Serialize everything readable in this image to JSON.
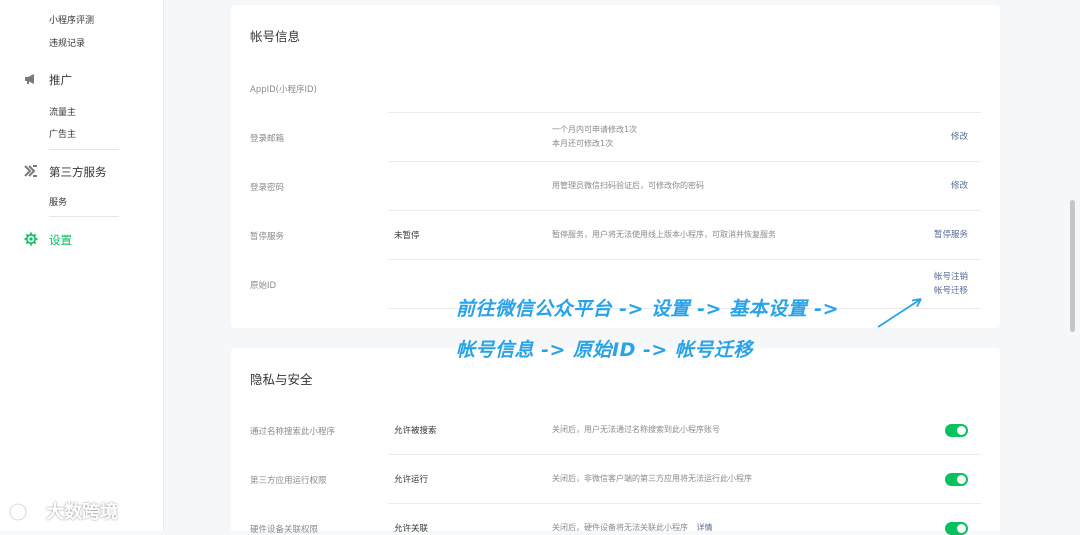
{
  "sidebar": {
    "sub_top": [
      "小程序评测",
      "违规记录"
    ],
    "sections": [
      {
        "label": "推广",
        "icon": "megaphone-icon",
        "items": [
          "流量主",
          "广告主"
        ]
      },
      {
        "label": "第三方服务",
        "icon": "third-party-icon",
        "items": [
          "服务"
        ]
      },
      {
        "label": "设置",
        "icon": "gear-icon",
        "items": []
      }
    ],
    "active_color": "#07c160"
  },
  "account": {
    "title": "帐号信息",
    "rows": [
      {
        "label": "AppID(小程序ID)",
        "value": "",
        "desc": [],
        "actions": []
      },
      {
        "label": "登录邮箱",
        "value": "",
        "desc": [
          "一个月内可申请修改1次",
          "本月还可修改1次"
        ],
        "actions": [
          "修改"
        ]
      },
      {
        "label": "登录密码",
        "value": "",
        "desc": [
          "用管理员微信扫码验证后，可修改你的密码"
        ],
        "actions": [
          "修改"
        ]
      },
      {
        "label": "暂停服务",
        "value": "未暂停",
        "desc": [
          "暂停服务，用户将无法使用线上版本小程序，可取消并恢复服务"
        ],
        "actions": [
          "暂停服务"
        ]
      },
      {
        "label": "原始ID",
        "value": "",
        "desc": [],
        "actions": [
          "帐号注销",
          "帐号迁移"
        ]
      }
    ]
  },
  "privacy": {
    "title": "隐私与安全",
    "rows": [
      {
        "label": "通过名称搜索此小程序",
        "value": "允许被搜索",
        "desc": "关闭后，用户无法通过名称搜索到此小程序账号",
        "toggle_on": true
      },
      {
        "label": "第三方应用运行权限",
        "value": "允许运行",
        "desc": "关闭后，非微信客户端的第三方应用将无法运行此小程序",
        "toggle_on": true
      },
      {
        "label": "硬件设备关联权限",
        "value": "允许关联",
        "desc": "关闭后，硬件设备将无法关联此小程序",
        "link": "详情",
        "toggle_on": true
      }
    ]
  },
  "annotation": {
    "line1": "前往微信公众平台 -> 设置 -> 基本设置 ->",
    "line2": "帐号信息 -> 原始ID -> 帐号迁移",
    "color": "#29a3e8"
  },
  "watermark": {
    "text": "大数跨境"
  }
}
